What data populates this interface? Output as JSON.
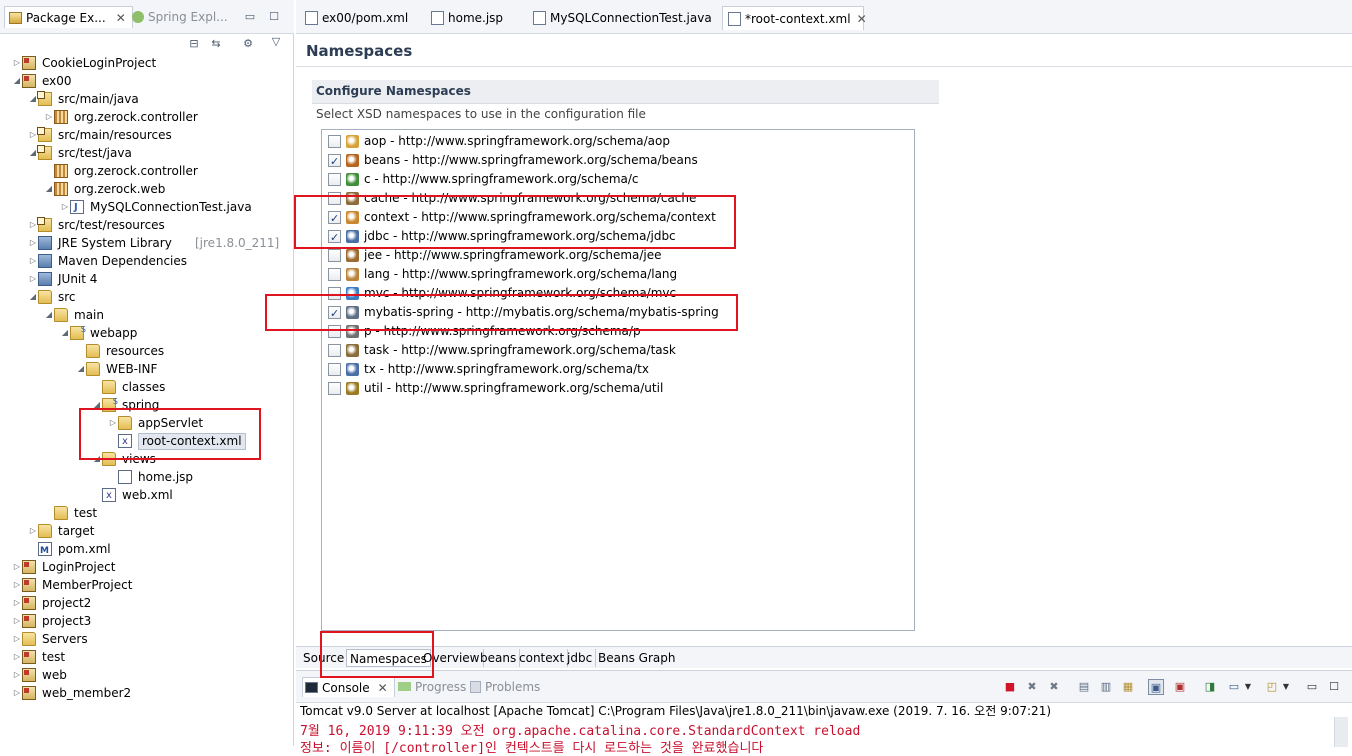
{
  "left_panel": {
    "tabs": [
      {
        "label": "Package Ex..."
      },
      {
        "label": "Spring Expl..."
      }
    ],
    "tree": [
      {
        "label": "CookieLoginProject",
        "icon": "maven-project-icon"
      },
      {
        "label": "ex00",
        "icon": "maven-project-icon"
      },
      {
        "label": "src/main/java",
        "icon": "source-folder-icon"
      },
      {
        "label": "org.zerock.controller",
        "icon": "package-icon"
      },
      {
        "label": "src/main/resources",
        "icon": "source-folder-icon"
      },
      {
        "label": "src/test/java",
        "icon": "source-folder-icon"
      },
      {
        "label": "org.zerock.controller",
        "icon": "package-icon"
      },
      {
        "label": "org.zerock.web",
        "icon": "package-icon"
      },
      {
        "label": "MySQLConnectionTest.java",
        "icon": "java-file-icon"
      },
      {
        "label": "src/test/resources",
        "icon": "source-folder-icon"
      },
      {
        "label": "JRE System Library",
        "suffix": "[jre1.8.0_211]",
        "icon": "library-icon"
      },
      {
        "label": "Maven Dependencies",
        "icon": "library-icon"
      },
      {
        "label": "JUnit 4",
        "icon": "library-icon"
      },
      {
        "label": "src",
        "icon": "folder-icon"
      },
      {
        "label": "main",
        "icon": "folder-icon"
      },
      {
        "label": "webapp",
        "icon": "spring-folder-icon"
      },
      {
        "label": "resources",
        "icon": "folder-icon"
      },
      {
        "label": "WEB-INF",
        "icon": "folder-icon"
      },
      {
        "label": "classes",
        "icon": "folder-icon"
      },
      {
        "label": "spring",
        "icon": "spring-folder-icon"
      },
      {
        "label": "appServlet",
        "icon": "folder-icon"
      },
      {
        "label": "root-context.xml",
        "icon": "spring-xml-icon"
      },
      {
        "label": "views",
        "icon": "folder-icon"
      },
      {
        "label": "home.jsp",
        "icon": "jsp-file-icon"
      },
      {
        "label": "web.xml",
        "icon": "xml-file-icon"
      },
      {
        "label": "test",
        "icon": "folder-icon"
      },
      {
        "label": "target",
        "icon": "folder-icon"
      },
      {
        "label": "pom.xml",
        "icon": "pom-file-icon"
      },
      {
        "label": "LoginProject",
        "icon": "maven-project-icon"
      },
      {
        "label": "MemberProject",
        "icon": "maven-project-icon"
      },
      {
        "label": "project2",
        "icon": "maven-project-icon"
      },
      {
        "label": "project3",
        "icon": "maven-project-icon"
      },
      {
        "label": "Servers",
        "icon": "folder-icon"
      },
      {
        "label": "test",
        "icon": "maven-project-icon"
      },
      {
        "label": "web",
        "icon": "maven-project-icon"
      },
      {
        "label": "web_member2",
        "icon": "maven-project-icon"
      }
    ]
  },
  "editor_tabs": [
    {
      "label": "ex00/pom.xml"
    },
    {
      "label": "home.jsp"
    },
    {
      "label": "MySQLConnectionTest.java"
    },
    {
      "label": "*root-context.xml",
      "active": true
    }
  ],
  "namespaces_page": {
    "title": "Namespaces",
    "section_title": "Configure Namespaces",
    "description": "Select XSD namespaces to use in the configuration file",
    "items": [
      {
        "label": "aop - http://www.springframework.org/schema/aop",
        "checked": false,
        "color": "#d8a23a"
      },
      {
        "label": "beans - http://www.springframework.org/schema/beans",
        "checked": true,
        "color": "#b5651d"
      },
      {
        "label": "c - http://www.springframework.org/schema/c",
        "checked": false,
        "color": "#3f8f3a"
      },
      {
        "label": "cache - http://www.springframework.org/schema/cache",
        "checked": false,
        "color": "#8e6b3a"
      },
      {
        "label": "context - http://www.springframework.org/schema/context",
        "checked": true,
        "color": "#c9872e"
      },
      {
        "label": "jdbc - http://www.springframework.org/schema/jdbc",
        "checked": true,
        "color": "#4a6fa5"
      },
      {
        "label": "jee - http://www.springframework.org/schema/jee",
        "checked": false,
        "color": "#9b6a2f"
      },
      {
        "label": "lang - http://www.springframework.org/schema/lang",
        "checked": false,
        "color": "#b9853d"
      },
      {
        "label": "mvc - http://www.springframework.org/schema/mvc",
        "checked": false,
        "color": "#3b7dc4"
      },
      {
        "label": "mybatis-spring - http://mybatis.org/schema/mybatis-spring",
        "checked": true,
        "color": "#5f6f86"
      },
      {
        "label": "p - http://www.springframework.org/schema/p",
        "checked": false,
        "color": "#707070"
      },
      {
        "label": "task - http://www.springframework.org/schema/task",
        "checked": false,
        "color": "#8a6d3b"
      },
      {
        "label": "tx - http://www.springframework.org/schema/tx",
        "checked": false,
        "color": "#4a6fa5"
      },
      {
        "label": "util - http://www.springframework.org/schema/util",
        "checked": false,
        "color": "#9a7b24"
      }
    ]
  },
  "bottom_tabs": [
    {
      "label": "Source"
    },
    {
      "label": "Namespaces",
      "active": true
    },
    {
      "label": "Overview"
    },
    {
      "label": "beans"
    },
    {
      "label": "context"
    },
    {
      "label": "jdbc"
    },
    {
      "label": "Beans Graph"
    }
  ],
  "console": {
    "tabs": [
      {
        "label": "Console"
      },
      {
        "label": "Progress"
      },
      {
        "label": "Problems"
      }
    ],
    "header": "Tomcat v9.0 Server at localhost [Apache Tomcat] C:\\Program Files\\Java\\jre1.8.0_211\\bin\\javaw.exe (2019. 7. 16. 오전 9:07:21)",
    "lines": [
      "7월 16, 2019 9:11:39 오전 org.apache.catalina.core.StandardContext reload",
      "정보: 이름이 [/controller]인 컨텍스트를 다시 로드하는 것을 완료했습니다"
    ]
  },
  "colors": {
    "highlight": "#e0141e",
    "console_error": "#c8102e"
  }
}
